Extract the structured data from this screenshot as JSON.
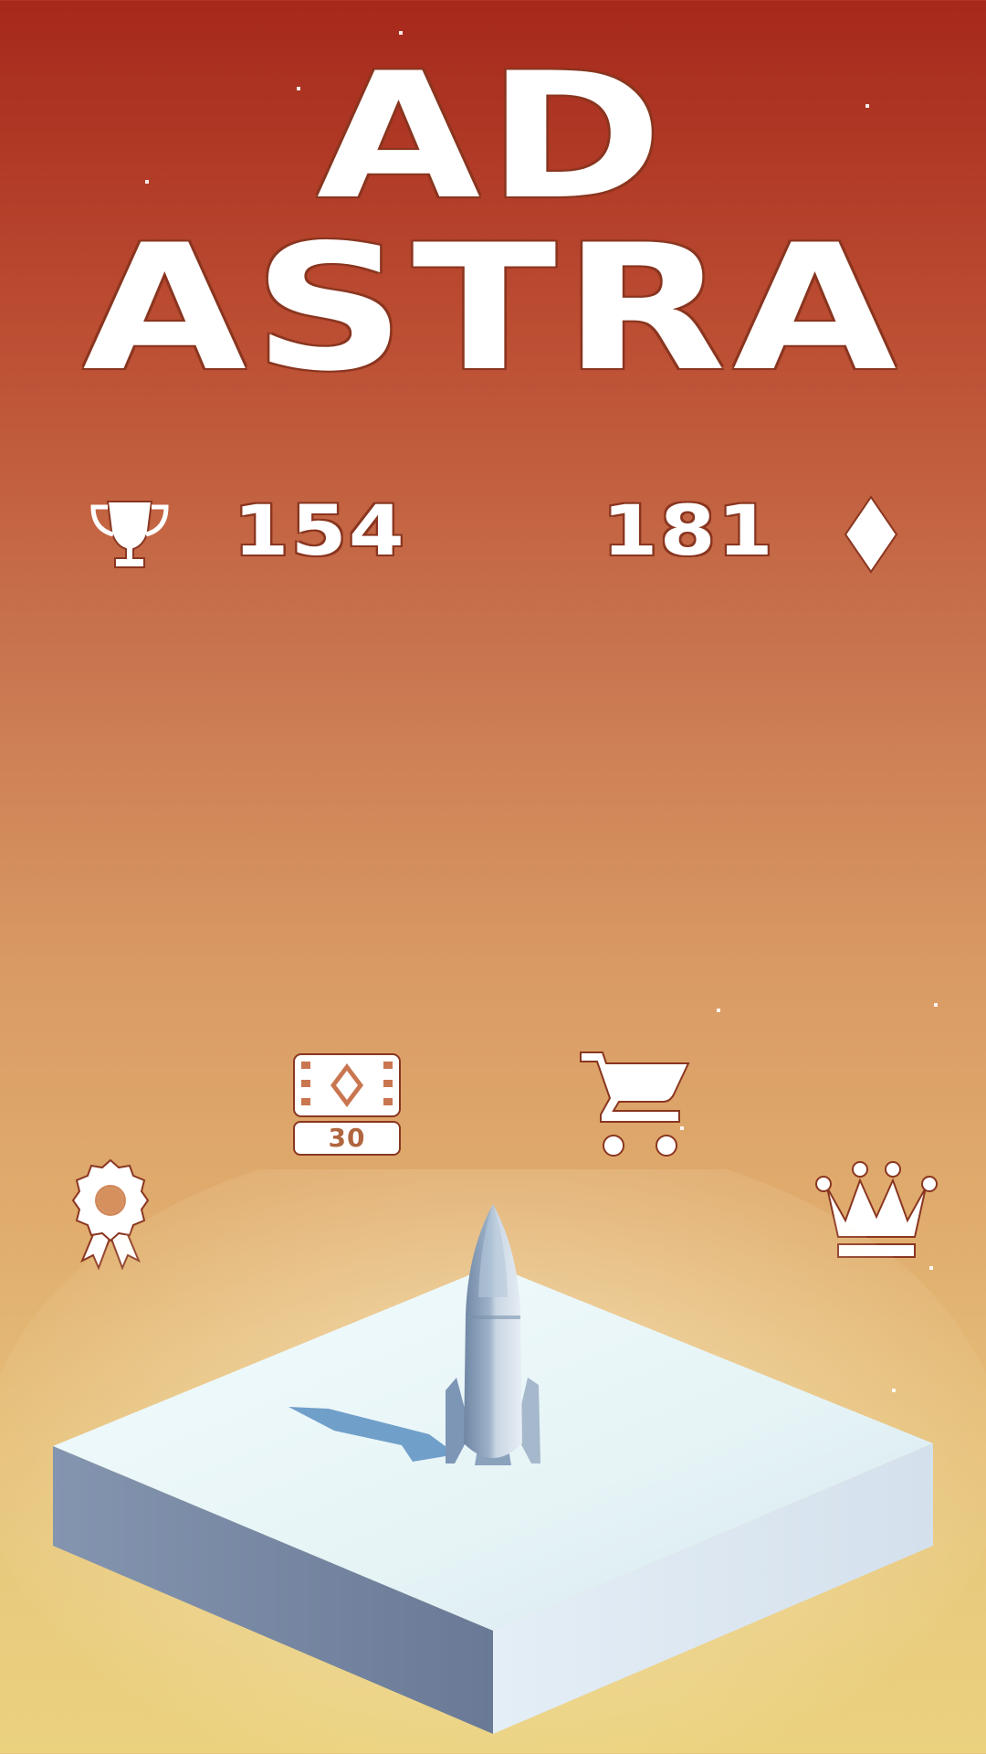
{
  "game": {
    "title_line1": "AD",
    "title_line2": "ASTRA"
  },
  "stats": {
    "best_score": "154",
    "gems": "181"
  },
  "rewarded_video": {
    "reward": "30"
  },
  "icons": {
    "trophy": "trophy-icon",
    "gem": "diamond-icon",
    "video_reward": "film-diamond-icon",
    "shop": "shopping-cart-icon",
    "achievements": "award-ribbon-icon",
    "leaderboard": "crown-icon"
  },
  "colors": {
    "sky_top": "#a6281b",
    "sky_bottom": "#ebd27f",
    "ui_white": "#ffffff",
    "platform_top": "#e9f4f6",
    "rocket": "#8aa2bc"
  }
}
